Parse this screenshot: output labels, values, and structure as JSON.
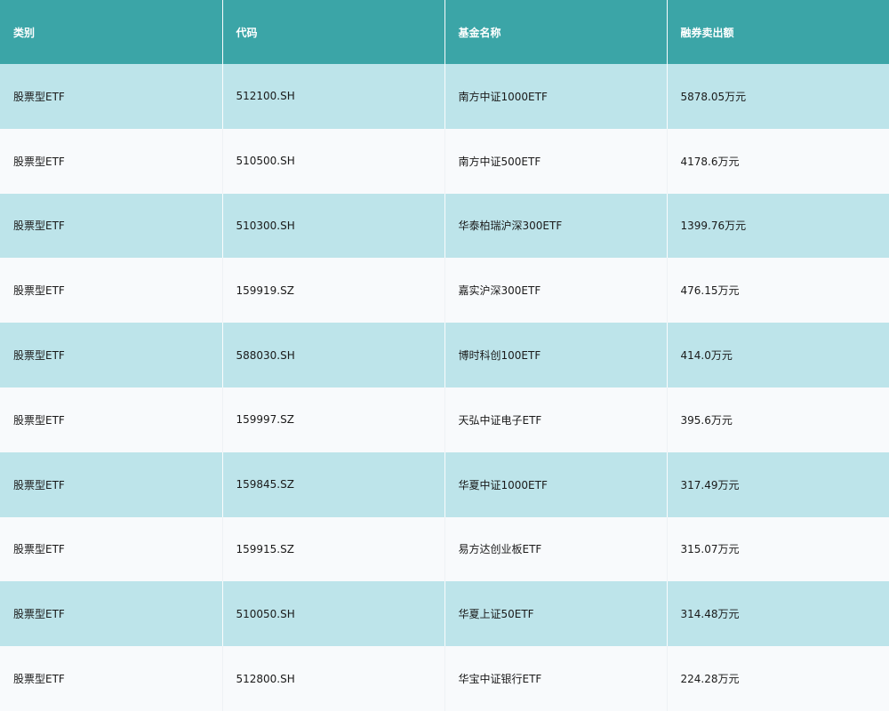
{
  "table": {
    "headers": [
      "类别",
      "代码",
      "基金名称",
      "融券卖出额"
    ],
    "rows": [
      [
        "股票型ETF",
        "512100.SH",
        "南方中证1000ETF",
        "5878.05万元"
      ],
      [
        "股票型ETF",
        "510500.SH",
        "南方中证500ETF",
        "4178.6万元"
      ],
      [
        "股票型ETF",
        "510300.SH",
        "华泰柏瑞沪深300ETF",
        "1399.76万元"
      ],
      [
        "股票型ETF",
        "159919.SZ",
        "嘉实沪深300ETF",
        "476.15万元"
      ],
      [
        "股票型ETF",
        "588030.SH",
        "博时科创100ETF",
        "414.0万元"
      ],
      [
        "股票型ETF",
        "159997.SZ",
        "天弘中证电子ETF",
        "395.6万元"
      ],
      [
        "股票型ETF",
        "159845.SZ",
        "华夏中证1000ETF",
        "317.49万元"
      ],
      [
        "股票型ETF",
        "159915.SZ",
        "易方达创业板ETF",
        "315.07万元"
      ],
      [
        "股票型ETF",
        "510050.SH",
        "华夏上证50ETF",
        "314.48万元"
      ],
      [
        "股票型ETF",
        "512800.SH",
        "华宝中证银行ETF",
        "224.28万元"
      ]
    ]
  },
  "colors": {
    "header_bg": "#3ba5a7",
    "row_alt_bg": "#bde4ea",
    "row_bg": "#f8fafc"
  }
}
